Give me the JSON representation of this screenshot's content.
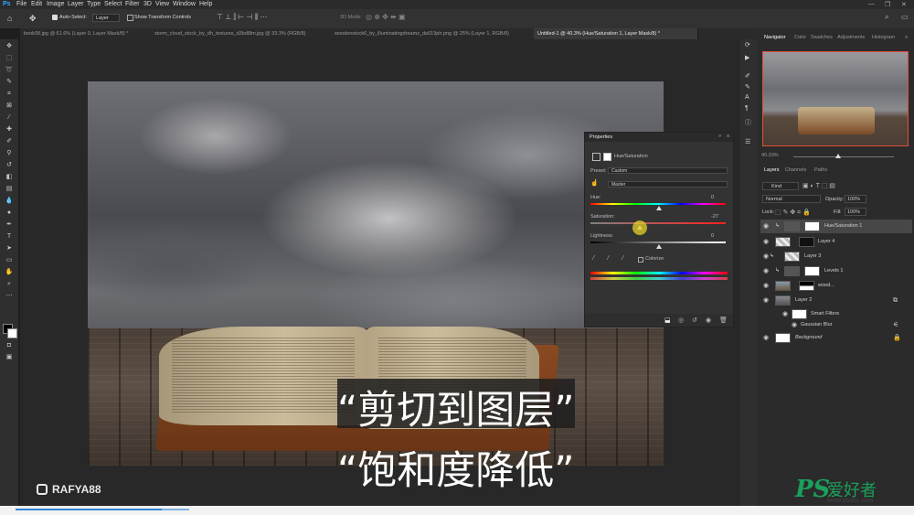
{
  "menu": [
    "File",
    "Edit",
    "Image",
    "Layer",
    "Type",
    "Select",
    "Filter",
    "3D",
    "View",
    "Window",
    "Help"
  ],
  "options_bar": {
    "auto_select_label": "Auto-Select:",
    "auto_select_value": "Layer",
    "show_transform": "Show Transform Controls",
    "mode_3d": "3D Mode:"
  },
  "tabs": [
    {
      "label": "book08.jpg @ 61.6% (Layer 0, Layer Mask/8) *"
    },
    {
      "label": "storm_cloud_stock_by_dh_textures_d3bd8lm.jpg @ 33.3% (RGB/8)"
    },
    {
      "label": "woodenstock6_by_illuminatingdreamz_da019ph.png @ 25% (Layer 1, RGB/8)"
    },
    {
      "label": "Untitled-1 @ 40.3% (Hue/Saturation 1, Layer Mask/8) *"
    }
  ],
  "subtitles": {
    "line1": "“剪切到图层”",
    "line2": "“饱和度降低”"
  },
  "watermark": "RAFYA88",
  "properties": {
    "title": "Properties",
    "adjustment": "Hue/Saturation",
    "preset_label": "Preset:",
    "preset_value": "Custom",
    "channel_value": "Master",
    "hue_label": "Hue:",
    "hue_value": "0",
    "saturation_label": "Saturation:",
    "saturation_value": "-27",
    "lightness_label": "Lightness:",
    "lightness_value": "0",
    "colorize_label": "Colorize"
  },
  "right_panel": {
    "tabs": [
      "Navigator",
      "Color",
      "Swatches",
      "Adjustments",
      "Histogram"
    ],
    "zoom": "40.33%",
    "layer_tabs": [
      "Layers",
      "Channels",
      "Paths"
    ],
    "kind": "Kind",
    "blend_mode": "Normal",
    "opacity_label": "Opacity:",
    "opacity_value": "100%",
    "lock_label": "Lock:",
    "fill_label": "Fill:",
    "fill_value": "100%",
    "layers": [
      {
        "name": "Hue/Saturation 1"
      },
      {
        "name": "Layer 4"
      },
      {
        "name": "Layer 3"
      },
      {
        "name": "Levels 1"
      },
      {
        "name": "wood..."
      },
      {
        "name": "Layer 2"
      },
      {
        "name": "Smart Filters"
      },
      {
        "name": "Gaussian Blur"
      },
      {
        "name": "Background"
      }
    ]
  },
  "site_logo": {
    "mark": "PS",
    "cn": "爱好者",
    "url": "www.psahz.com"
  }
}
